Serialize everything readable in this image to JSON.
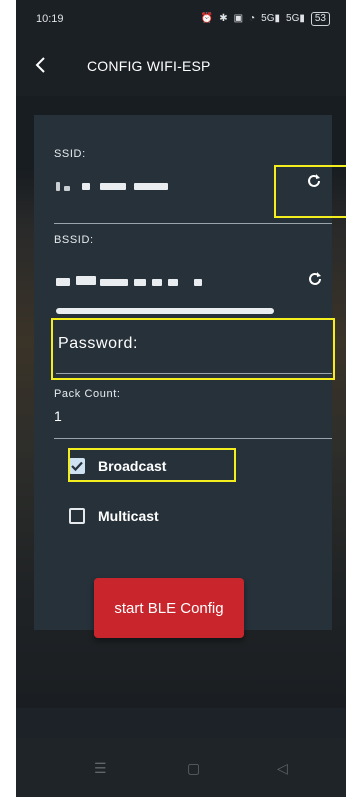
{
  "status_bar": {
    "time": "10:19",
    "icons": [
      "alarm-icon",
      "bluetooth-icon",
      "nfc-icon",
      "wifi-icon",
      "signal-icon",
      "signal-icon"
    ],
    "signal_label_1": "5G",
    "signal_label_2": "5G",
    "battery": "53"
  },
  "app_bar": {
    "title": "CONFIG WIFI-ESP"
  },
  "form": {
    "ssid_label": "SSID:",
    "bssid_label": "BSSID:",
    "password_label": "Password:",
    "pack_count_label": "Pack Count:",
    "pack_count_value": "1",
    "broadcast_label": "Broadcast",
    "broadcast_checked": true,
    "multicast_label": "Multicast",
    "multicast_checked": false,
    "start_button": "start BLE Config"
  },
  "colors": {
    "highlight": "#f4ee1e",
    "button": "#c8262c",
    "card": "#26313a"
  }
}
